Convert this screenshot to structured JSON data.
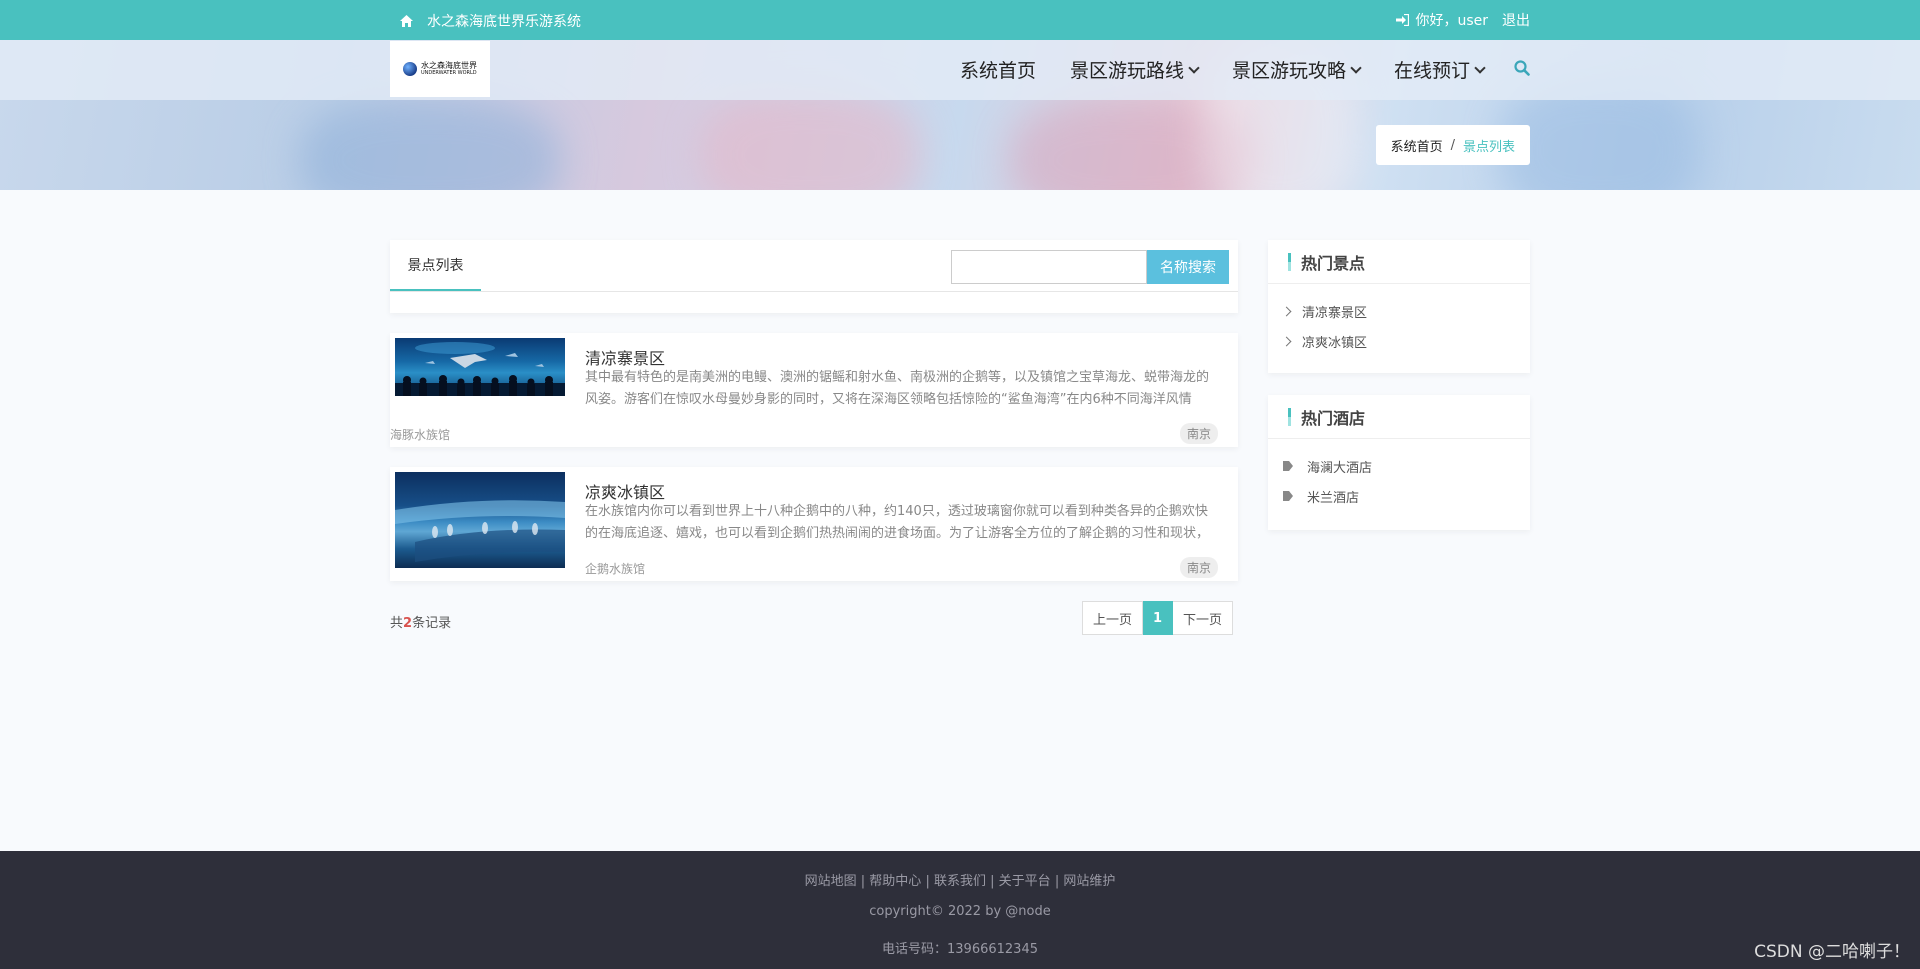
{
  "topbar": {
    "site_name": "水之森海底世界乐游系统",
    "greeting": "你好，user",
    "logout": "退出"
  },
  "logo": {
    "text_line1": "水之森海底世界",
    "text_line2": "UNDERWATER WORLD"
  },
  "nav": {
    "items": [
      {
        "label": "系统首页",
        "dropdown": false
      },
      {
        "label": "景区游玩路线",
        "dropdown": true
      },
      {
        "label": "景区游玩攻略",
        "dropdown": true
      },
      {
        "label": "在线预订",
        "dropdown": true
      }
    ]
  },
  "breadcrumb": {
    "home": "系统首页",
    "sep": "/",
    "current": "景点列表"
  },
  "list": {
    "tab": "景点列表",
    "search_button": "名称搜索",
    "search_placeholder": ""
  },
  "spots": [
    {
      "title": "清凉寨景区",
      "desc": "其中最有特色的是南美洲的电鳗、澳洲的锯鳐和射水鱼、南极洲的企鹅等，以及镇馆之宝草海龙、蜕带海龙的风姿。游客们在惊叹水母曼妙身影的同时，又将在深海区领略包括惊险的“鲨鱼海湾”在内6种不同海洋风情",
      "venue": "海豚水族馆",
      "city": "南京"
    },
    {
      "title": "凉爽冰镇区",
      "desc": "在水族馆内你可以看到世界上十八种企鹅中的八种，约140只，透过玻璃窗你就可以看到种类各异的企鹅欢快的在海底追逐、嬉戏，也可以看到企鹅们热热闹闹的进食场面。为了让游客全方位的了解企鹅的习性和现状，",
      "venue": "企鹅水族馆",
      "city": "南京"
    }
  ],
  "pagination": {
    "count_prefix": "共",
    "count": "2",
    "count_suffix": "条记录",
    "prev": "上一页",
    "current": "1",
    "next": "下一页"
  },
  "sidebar": {
    "hot_spots": {
      "title": "热门景点",
      "items": [
        "清凉寨景区",
        "凉爽冰镇区"
      ]
    },
    "hot_hotels": {
      "title": "热门酒店",
      "items": [
        "海澜大酒店",
        "米兰酒店"
      ]
    }
  },
  "footer": {
    "links": [
      "网站地图",
      "帮助中心",
      "联系我们",
      "关于平台",
      "网站维护"
    ],
    "separator": "|",
    "copyright": "copyright© 2022 by @node",
    "phone": "电话号码：13966612345"
  },
  "watermark": "CSDN @二哈喇子！",
  "colors": {
    "primary": "#49c1bf",
    "search_button": "#5bc0de",
    "footer_bg": "#2e2f3a"
  }
}
